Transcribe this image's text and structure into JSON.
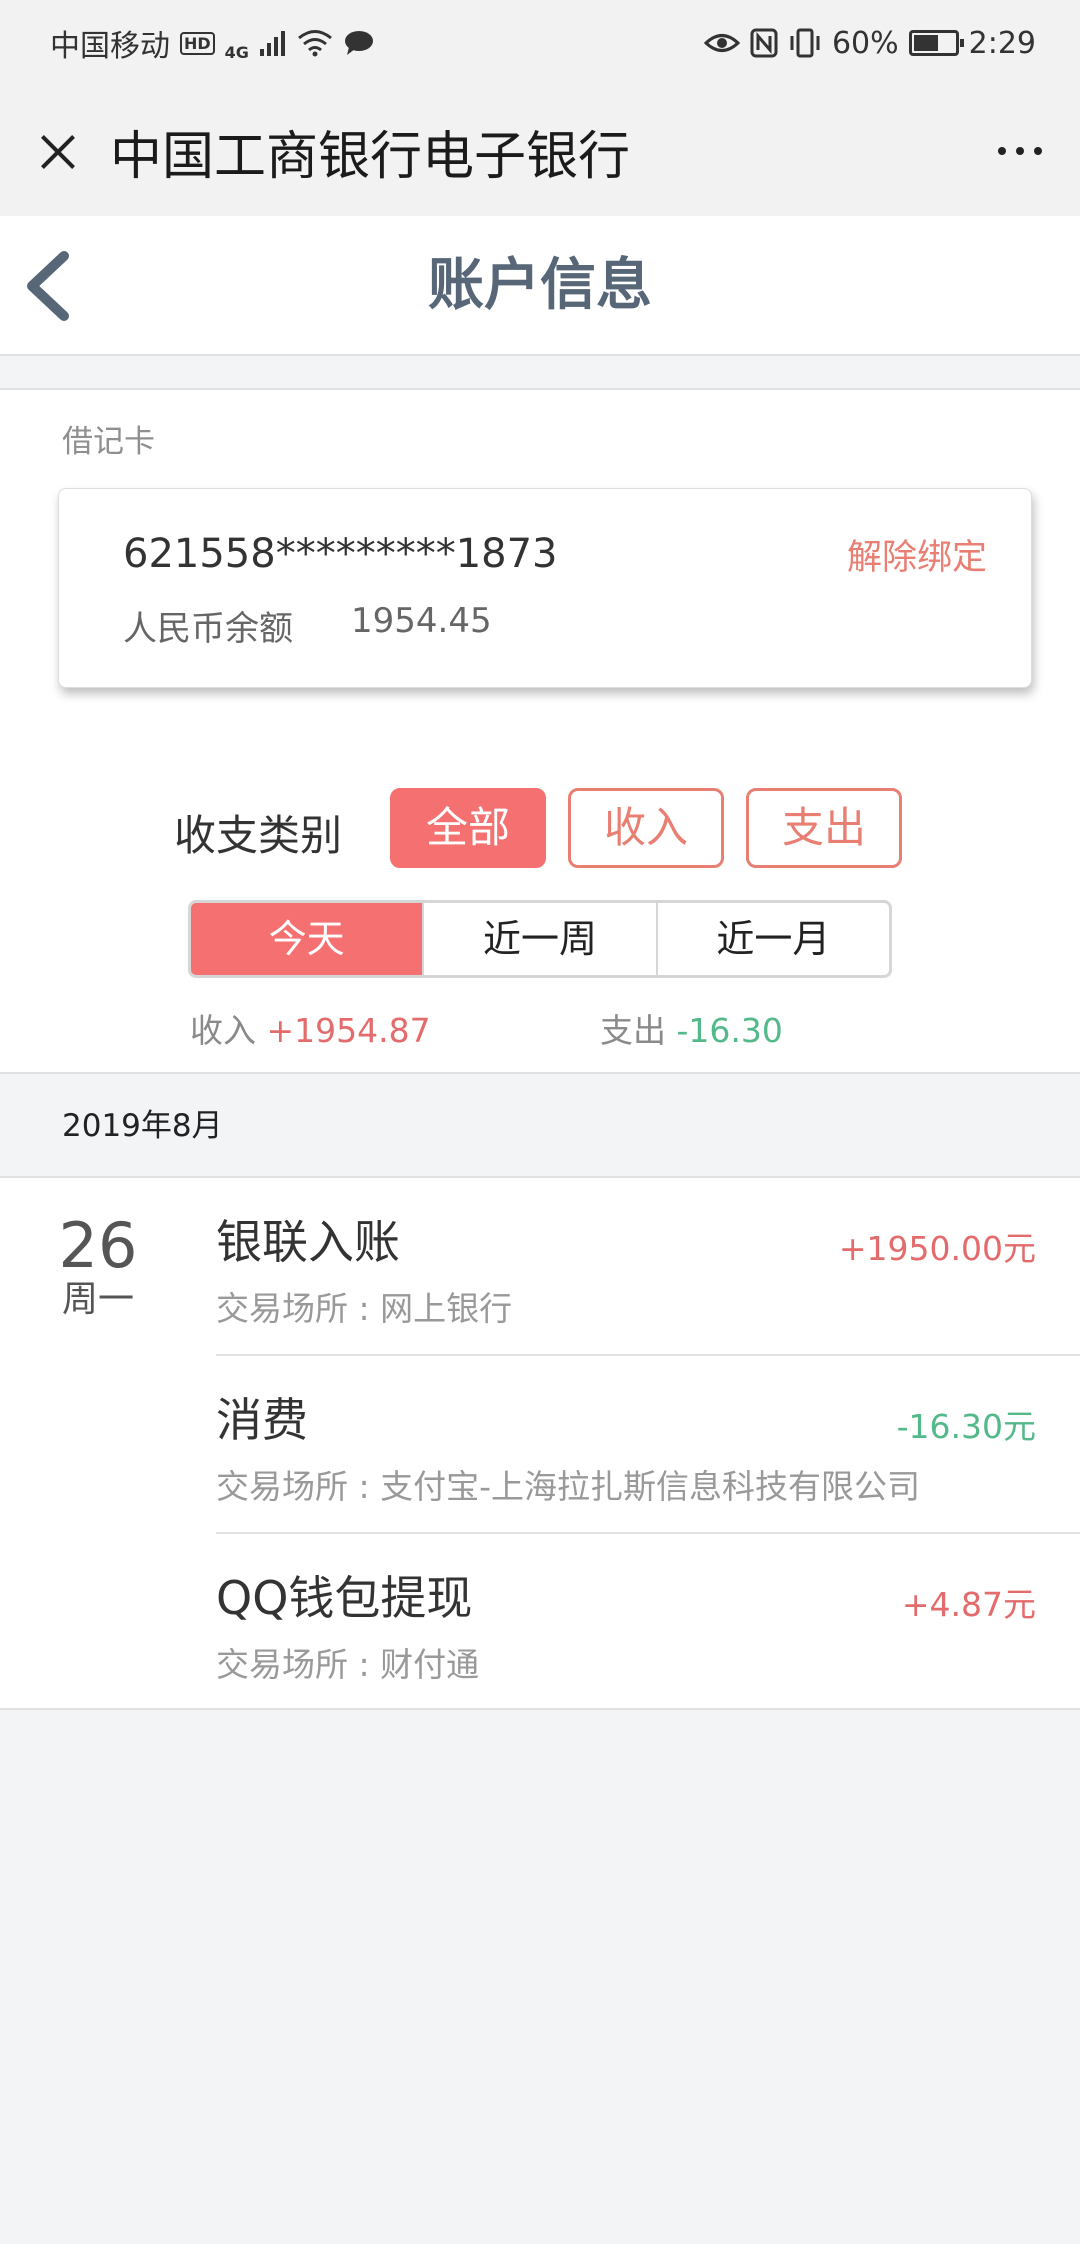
{
  "status_bar": {
    "carrier": "中国移动",
    "hd": "HD",
    "network": "4G",
    "battery": "60%",
    "battery_level": 0.6,
    "time": "2:29"
  },
  "titlebar": {
    "title": "中国工商银行电子银行"
  },
  "navbar": {
    "title": "账户信息"
  },
  "card": {
    "type_label": "借记卡",
    "number": "621558*********1873",
    "unbind_label": "解除绑定",
    "balance_label": "人民币余额",
    "balance_value": "1954.45"
  },
  "filters": {
    "category_label": "收支类别",
    "categories": [
      "全部",
      "收入",
      "支出"
    ],
    "selected_category": "全部",
    "periods": [
      "今天",
      "近一周",
      "近一月"
    ],
    "selected_period": "今天"
  },
  "summary": {
    "income_label": "收入",
    "income_value": "+1954.87",
    "expense_label": "支出",
    "expense_value": "-16.30"
  },
  "month_header": "2019年8月",
  "day": {
    "date": "26",
    "weekday": "周一"
  },
  "transactions": [
    {
      "name": "银联入账",
      "place": "交易场所 : 网上银行",
      "amount": "+1950.00元",
      "sign": "pos"
    },
    {
      "name": "消费",
      "place": "交易场所 : 支付宝-上海拉扎斯信息科技有限公司",
      "amount": "-16.30元",
      "sign": "neg"
    },
    {
      "name": "QQ钱包提现",
      "place": "交易场所 : 财付通",
      "amount": "+4.87元",
      "sign": "pos"
    }
  ],
  "colors": {
    "accent": "#f57070",
    "income": "#e36b6b",
    "expense": "#53b88a",
    "nav_title": "#576777"
  }
}
